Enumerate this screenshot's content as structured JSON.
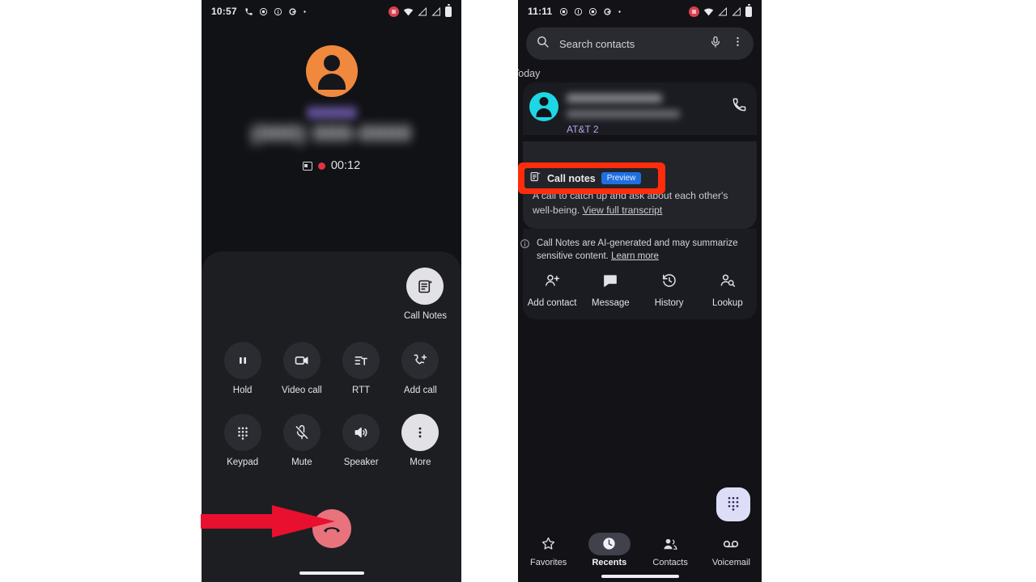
{
  "left_phone": {
    "status_bar": {
      "time": "10:57",
      "icons": [
        "phone-call-icon",
        "record-circle-icon",
        "info-circle-icon",
        "google-g-icon",
        "dot-icon"
      ],
      "right_icons": [
        "screen-record-icon",
        "wifi-icon",
        "signal-1-icon",
        "signal-2-icon",
        "battery-icon"
      ]
    },
    "call": {
      "avatar": "person-avatar-icon",
      "contact_label_redacted": true,
      "contact_number_redacted": true,
      "recording_icon": "call-recording-icon",
      "recording_dot": "red-record-dot",
      "duration": "00:12"
    },
    "call_notes": {
      "label": "Call Notes",
      "icon": "call-notes-icon"
    },
    "controls": [
      {
        "label": "Hold",
        "icon": "pause-icon",
        "highlighted": false
      },
      {
        "label": "Video call",
        "icon": "video-camera-icon",
        "highlighted": false
      },
      {
        "label": "RTT",
        "icon": "rtt-text-icon",
        "highlighted": false
      },
      {
        "label": "Add call",
        "icon": "add-call-icon",
        "highlighted": false
      },
      {
        "label": "Keypad",
        "icon": "dialpad-icon",
        "highlighted": false
      },
      {
        "label": "Mute",
        "icon": "microphone-off-icon",
        "highlighted": false
      },
      {
        "label": "Speaker",
        "icon": "speaker-icon",
        "highlighted": false
      },
      {
        "label": "More",
        "icon": "more-vertical-icon",
        "highlighted": true
      }
    ],
    "end_call": {
      "icon": "end-call-icon",
      "color": "#e8737d"
    },
    "annotation": {
      "type": "red-arrow",
      "color": "#e8102e",
      "points_to": "end-call-button"
    }
  },
  "right_phone": {
    "status_bar": {
      "time": "11:11",
      "icons": [
        "record-circle-icon",
        "info-circle-icon",
        "record-circle-icon",
        "google-g-icon",
        "dot-icon"
      ],
      "right_icons": [
        "screen-record-icon",
        "wifi-icon",
        "signal-1-icon",
        "signal-2-icon",
        "battery-icon"
      ]
    },
    "search": {
      "placeholder": "Search contacts",
      "search_icon": "search-icon",
      "mic_icon": "microphone-icon",
      "overflow_icon": "more-vertical-icon"
    },
    "section_header": "Today",
    "recent": {
      "avatar": "person-avatar-icon",
      "name_redacted": true,
      "subtitle_redacted": true,
      "carrier": "AT&T 2",
      "call_back_icon": "phone-call-icon"
    },
    "call_notes_card": {
      "title": "Call notes",
      "icon": "call-notes-icon",
      "badge": "Preview",
      "badge_color": "#1f6fe0",
      "highlight_color": "#ff2d0c",
      "summary": "A call to catch up and ask about each other's well-being. ",
      "transcript_link": "View full transcript"
    },
    "disclaimer": {
      "icon": "info-circle-icon",
      "text": "Call Notes are AI-generated and may summarize sensitive content. ",
      "link": "Learn more"
    },
    "actions": [
      {
        "label": "Add contact",
        "icon": "add-person-icon"
      },
      {
        "label": "Message",
        "icon": "message-icon"
      },
      {
        "label": "History",
        "icon": "history-icon"
      },
      {
        "label": "Lookup",
        "icon": "person-search-icon"
      }
    ],
    "fab": {
      "icon": "dialpad-icon",
      "color": "#ddddf8"
    },
    "bottom_nav": [
      {
        "label": "Favorites",
        "icon": "star-icon",
        "active": false
      },
      {
        "label": "Recents",
        "icon": "clock-icon",
        "active": true
      },
      {
        "label": "Contacts",
        "icon": "people-icon",
        "active": false
      },
      {
        "label": "Voicemail",
        "icon": "voicemail-icon",
        "active": false
      }
    ]
  }
}
